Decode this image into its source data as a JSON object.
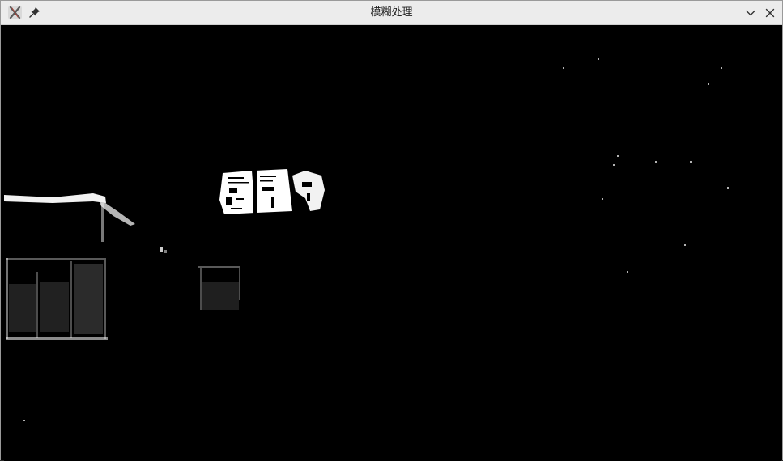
{
  "window": {
    "title": "模糊处理",
    "app_icon": "x-app-icon",
    "controls": [
      "pin-icon",
      "chevron-down-icon",
      "close-icon"
    ]
  },
  "colors": {
    "titlebar_bg": "#ececec",
    "title_text": "#222222",
    "canvas_bg": "#000000",
    "foreground": "#ffffff"
  }
}
